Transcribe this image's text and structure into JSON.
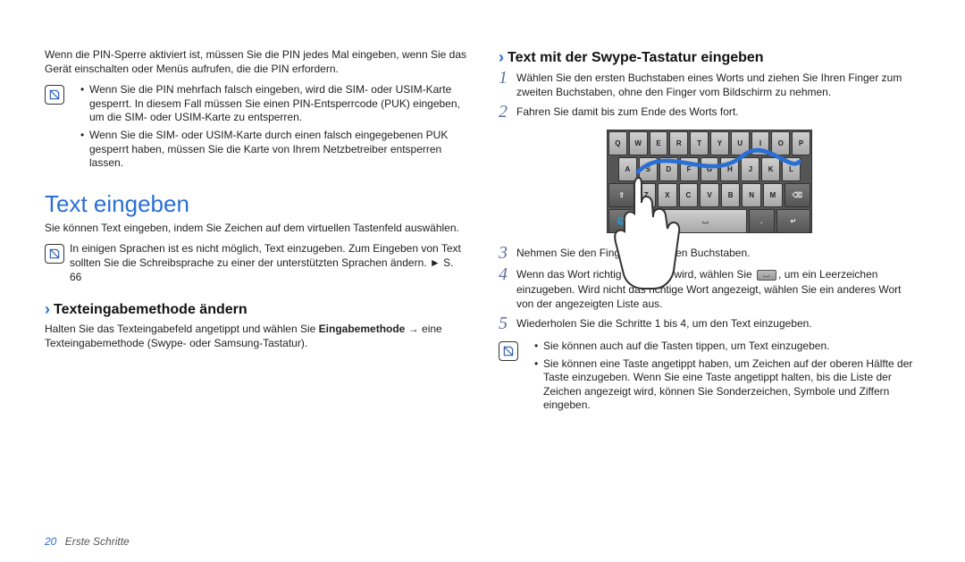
{
  "left": {
    "intro_pin": "Wenn die PIN-Sperre aktiviert ist, müssen Sie die PIN jedes Mal eingeben, wenn Sie das Gerät einschalten oder Menüs aufrufen, die die PIN erfordern.",
    "pin_note": {
      "items": [
        "Wenn Sie die PIN mehrfach falsch eingeben, wird die SIM- oder USIM-Karte gesperrt. In diesem Fall müssen Sie einen PIN-Entsperrcode (PUK) eingeben, um die SIM- oder USIM-Karte zu entsperren.",
        "Wenn Sie die SIM- oder USIM-Karte durch einen falsch eingegebenen PUK gesperrt haben, müssen Sie die Karte von Ihrem Netzbetreiber entsperren lassen."
      ]
    },
    "heading": "Text eingeben",
    "heading_sub": "Sie können Text eingeben, indem Sie Zeichen auf dem virtuellen Tastenfeld auswählen.",
    "lang_note": "In einigen Sprachen ist es nicht möglich, Text einzugeben. Zum Eingeben von Text sollten Sie die Schreibsprache zu einer der unterstützten Sprachen ändern. ► S. 66",
    "sub_change": "Texteingabemethode ändern",
    "sub_change_body_a": "Halten Sie das Texteingabefeld angetippt und wählen Sie ",
    "sub_change_body_b": "Eingabemethode",
    "sub_change_body_c": " → eine Texteingabemethode (Swype- oder Samsung-Tastatur)."
  },
  "right": {
    "sub_swype": "Text mit der Swype-Tastatur eingeben",
    "steps": {
      "1": "Wählen Sie den ersten Buchstaben eines Worts und ziehen Sie Ihren Finger zum zweiten Buchstaben, ohne den Finger vom Bildschirm zu nehmen.",
      "2": "Fahren Sie damit bis zum Ende des Worts fort.",
      "3": "Nehmen Sie den Finger vom letzten Buchstaben.",
      "4a": "Wenn das Wort richtig angezeigt wird, wählen Sie ",
      "4b": ", um ein Leerzeichen einzugeben. Wird nicht das richtige Wort angezeigt, wählen Sie ein anderes Wort von der angezeigten Liste aus.",
      "5": "Wiederholen Sie die Schritte 1 bis 4, um den Text einzugeben."
    },
    "swype_note": {
      "items": [
        "Sie können auch auf die Tasten tippen, um Text einzugeben.",
        "Sie können eine Taste angetippt haben, um Zeichen auf der oberen Hälfte der Taste einzugeben. Wenn Sie eine Taste angetippt halten, bis die Liste der Zeichen angezeigt wird, können Sie Sonderzeichen, Symbole und Ziffern eingeben."
      ]
    }
  },
  "footer": {
    "page": "20",
    "section": "Erste Schritte"
  },
  "keyboard": {
    "row1": [
      "Q",
      "W",
      "E",
      "R",
      "T",
      "Y",
      "U",
      "I",
      "O",
      "P"
    ],
    "row2": [
      "A",
      "S",
      "D",
      "F",
      "G",
      "H",
      "J",
      "K",
      "L"
    ],
    "row3": [
      "Z",
      "X",
      "C",
      "V",
      "B",
      "N",
      "M"
    ]
  }
}
